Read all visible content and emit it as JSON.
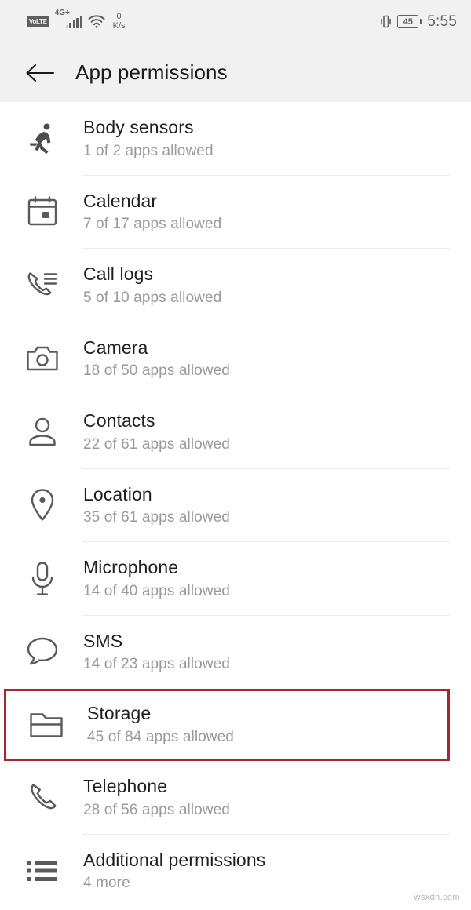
{
  "statusbar": {
    "volte_label": "VoLTE",
    "network_label": "4G+",
    "speed_value": "0",
    "speed_unit": "K/s",
    "vibrate_icon": "vibrate-icon",
    "battery_level": "45",
    "clock": "5:55",
    "icons": [
      "volte-icon",
      "signal-bars-icon",
      "wifi-icon",
      "vibrate-icon",
      "battery-icon"
    ],
    "bg_color": "#f1f1f1",
    "fg_color": "#5f5f5f"
  },
  "toolbar": {
    "back_icon": "back-arrow-icon",
    "title": "App permissions",
    "bg_color": "#f1f1f1",
    "title_color": "#1b1b1b"
  },
  "highlight": {
    "color": "#a32833",
    "target": "Storage"
  },
  "permissions": [
    {
      "icon": "running-person-icon",
      "label": "Body sensors",
      "status": "1 of 2 apps allowed",
      "highlighted": false
    },
    {
      "icon": "calendar-icon",
      "label": "Calendar",
      "status": "7 of 17 apps allowed",
      "highlighted": false
    },
    {
      "icon": "call-logs-icon",
      "label": "Call logs",
      "status": "5 of 10 apps allowed",
      "highlighted": false
    },
    {
      "icon": "camera-icon",
      "label": "Camera",
      "status": "18 of 50 apps allowed",
      "highlighted": false
    },
    {
      "icon": "contacts-person-icon",
      "label": "Contacts",
      "status": "22 of 61 apps allowed",
      "highlighted": false
    },
    {
      "icon": "location-pin-icon",
      "label": "Location",
      "status": "35 of 61 apps allowed",
      "highlighted": false
    },
    {
      "icon": "microphone-icon",
      "label": "Microphone",
      "status": "14 of 40 apps allowed",
      "highlighted": false
    },
    {
      "icon": "sms-bubble-icon",
      "label": "SMS",
      "status": "14 of 23 apps allowed",
      "highlighted": false
    },
    {
      "icon": "folder-icon",
      "label": "Storage",
      "status": "45 of 84 apps allowed",
      "highlighted": true
    },
    {
      "icon": "telephone-icon",
      "label": "Telephone",
      "status": "28 of 56 apps allowed",
      "highlighted": false
    },
    {
      "icon": "list-bullets-icon",
      "label": "Additional permissions",
      "status": "4 more",
      "highlighted": false
    }
  ],
  "watermark": "wsxdn.com"
}
